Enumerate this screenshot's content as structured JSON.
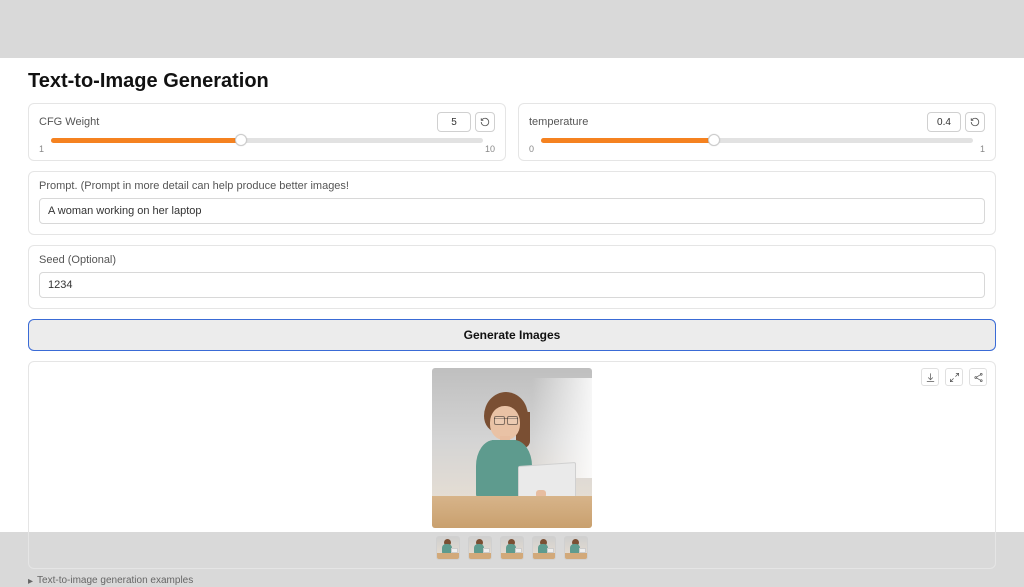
{
  "title": "Text-to-Image Generation",
  "sliders": {
    "cfg": {
      "label": "CFG Weight",
      "value": "5",
      "min": "1",
      "max": "10",
      "fill_pct": 44
    },
    "temperature": {
      "label": "temperature",
      "value": "0.4",
      "min": "0",
      "max": "1",
      "fill_pct": 40
    }
  },
  "prompt": {
    "label": "Prompt. (Prompt in more detail can help produce better images!",
    "value": "A woman working on her laptop"
  },
  "seed": {
    "label": "Seed (Optional)",
    "value": "1234"
  },
  "generate_button": "Generate Images",
  "output": {
    "thumbnails_count": 5
  },
  "footer": {
    "examples_label": "Text-to-image generation examples"
  },
  "icons": {
    "reset": "reset-icon",
    "download": "download-icon",
    "share": "share-icon",
    "expand": "expand-icon"
  }
}
